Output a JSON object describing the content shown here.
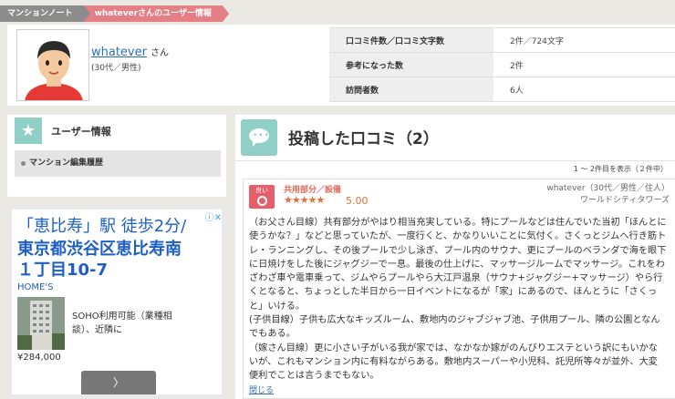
{
  "breadcrumb": {
    "items": [
      "マンションノート",
      "whateverさんのユーザー情報"
    ]
  },
  "profile": {
    "username": "whatever",
    "honorific": "さん",
    "demographic": "(30代／男性)",
    "stats": [
      {
        "label": "口コミ件数／口コミ文字数",
        "value": "2件／724文字"
      },
      {
        "label": "参考になった数",
        "value": "2件"
      },
      {
        "label": "訪問者数",
        "value": "6人"
      }
    ]
  },
  "sidebar": {
    "icon": "star-icon",
    "title": "ユーザー情報",
    "links": [
      "マンション編集履歴"
    ]
  },
  "ad": {
    "line1": "「恵比寿」駅 徒歩2分/",
    "line2": "東京都渋谷区恵比寿南",
    "line3": "１丁目10-7",
    "brand": "HOME'S",
    "description": "SOHO利用可能（業種相談）、近隣に",
    "price": "¥284,000",
    "button": "〉"
  },
  "main": {
    "title": "投稿した口コミ（2）",
    "count": "1 〜 2件目を表示（２件中）",
    "review": {
      "badge_text": "良い",
      "category": "共用部分／設備",
      "rating": "5.00",
      "stars": "★★★★★",
      "author": "whatever（30代／男性／住人）",
      "property": "ワールドシティタワーズ",
      "paragraphs": [
        "（お父さん目線）共有部分がやはり相当充実している。特にプールなどは住んでいた当初「ほんとに使うかな？」などと思っていたが、一度行くと、かなりいいことに気付く。さくっとジムへ行き筋トレ・ランニングし、その後プールで少し泳ぎ、プール内のサウナ、更にプールのベランダで海を眼下に日焼けをした後にジャグジーで一息。最後の仕上げに、マッサージルームでマッサージ。これをわざわざ車や電車乗って、ジムやらプールやら大江戸温泉（サウナ+ジャグジー+マッサージ）やら行くとなると、ちょっとした半日から一日イベントになるが「家」にあるので、ほんとうに「さくっと」いける。",
        "(子供目線）子供も広大なキッズルーム、敷地内のジャブジャブ池、子供用プール、隣の公園となんでもある。",
        "（嫁さん目線）更に小さい子がいる我が家では、なかなか嫁がのんびりエステという訳にもいかないが、これもマンション内に有料ながらある。敷地内スーパーや小児科、託児所等々が並外、大変便利でことは言うまでもない。"
      ],
      "close_link": "閉じる"
    }
  },
  "colors": {
    "accent_teal": "#8fcfc6",
    "accent_pink": "#e57f86",
    "link_blue": "#2d6fb8",
    "star_orange": "#e0703c"
  }
}
